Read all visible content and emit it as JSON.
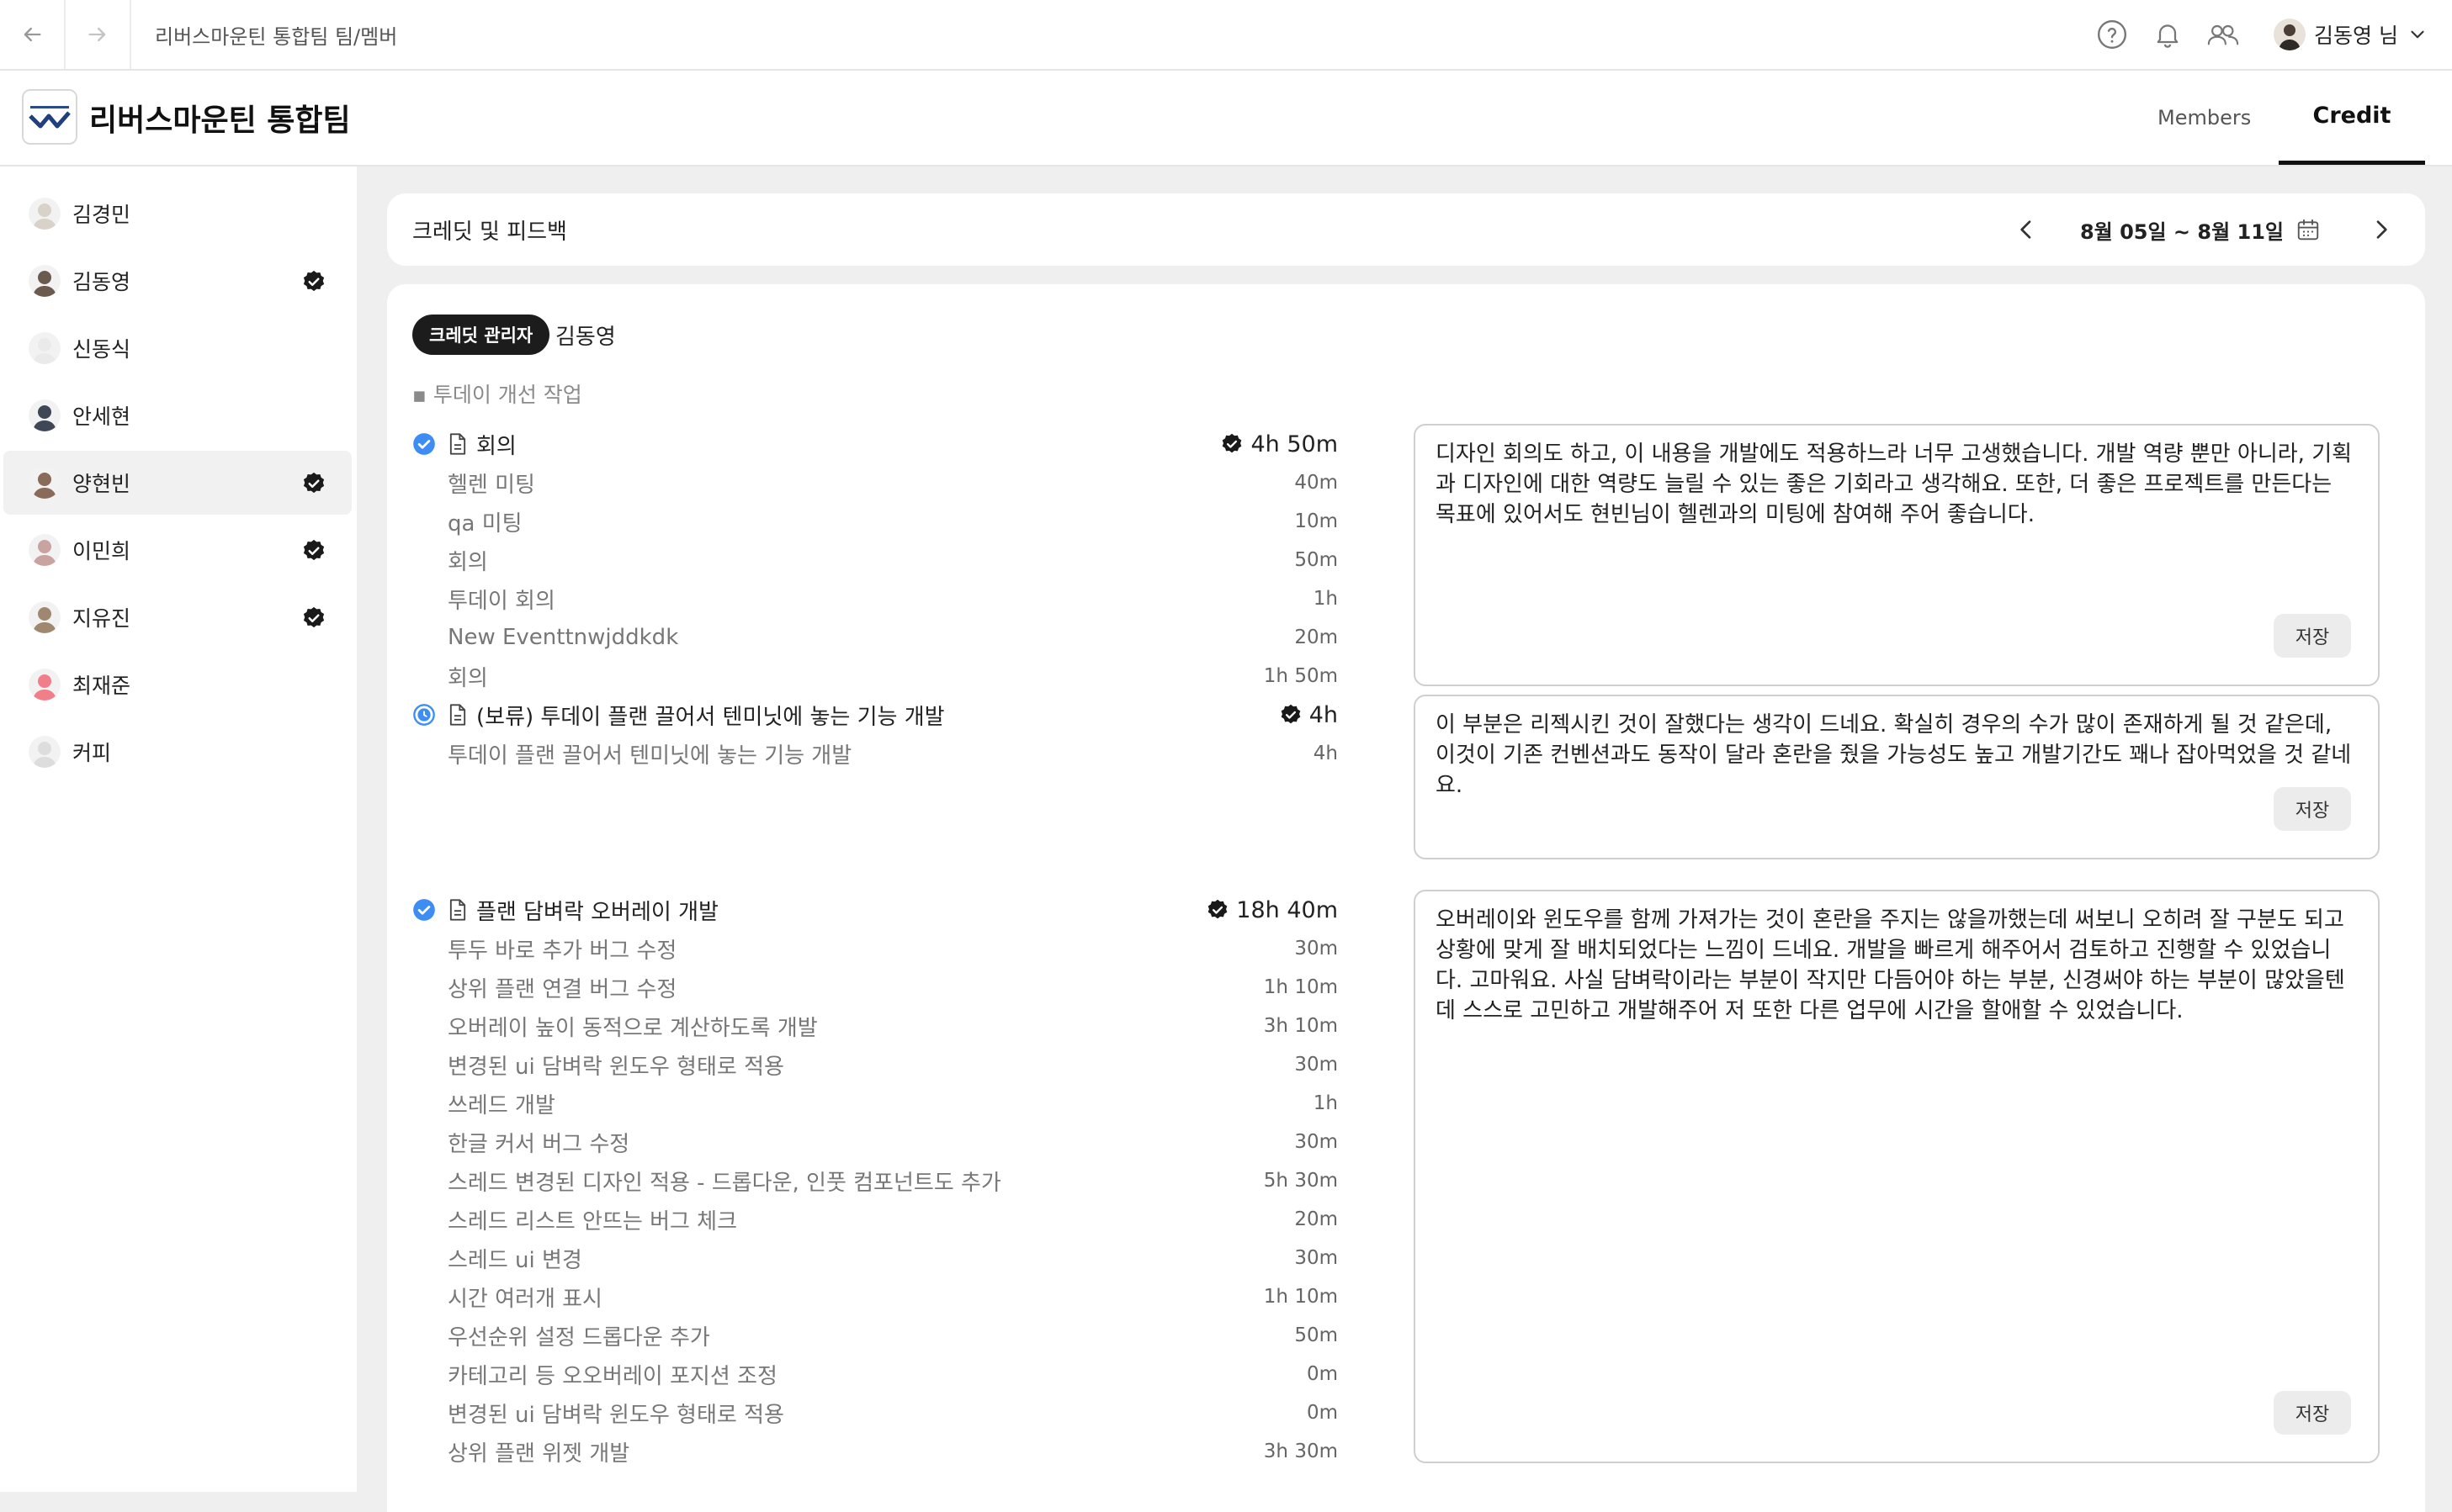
{
  "topbar": {
    "back_icon": "arrow-left-icon",
    "forward_icon": "arrow-right-icon",
    "breadcrumb": "리버스마운틴 통합팀 팀/멤버",
    "help_icon": "question-circle-icon",
    "bell_icon": "bell-icon",
    "people_icon": "people-icon",
    "user_name": "김동영 님",
    "dropdown_icon": "chevron-down-icon"
  },
  "team": {
    "name": "리버스마운틴 통합팀",
    "tabs": [
      {
        "label": "Members",
        "active": false
      },
      {
        "label": "Credit",
        "active": true
      }
    ]
  },
  "sidebar": {
    "members": [
      {
        "name": "김경민",
        "verified": false,
        "selected": false,
        "avatar_color": "#d9d2c8"
      },
      {
        "name": "김동영",
        "verified": true,
        "selected": false,
        "avatar_color": "#6b5b4f"
      },
      {
        "name": "신동식",
        "verified": false,
        "selected": false,
        "avatar_color": "#eaeaea"
      },
      {
        "name": "안세현",
        "verified": false,
        "selected": false,
        "avatar_color": "#3f4656"
      },
      {
        "name": "양현빈",
        "verified": true,
        "selected": true,
        "avatar_color": "#8a6a58"
      },
      {
        "name": "이민희",
        "verified": true,
        "selected": false,
        "avatar_color": "#c9a3a0"
      },
      {
        "name": "지유진",
        "verified": true,
        "selected": false,
        "avatar_color": "#a08870"
      },
      {
        "name": "최재준",
        "verified": false,
        "selected": false,
        "avatar_color": "#f07f8a"
      },
      {
        "name": "커피",
        "verified": false,
        "selected": false,
        "avatar_color": "#dddddd"
      }
    ]
  },
  "header_card": {
    "title": "크레딧 및 피드백",
    "prev_icon": "chevron-left-icon",
    "week": "8월 05일 ~ 8월 11일",
    "calendar_icon": "calendar-icon",
    "next_icon": "chevron-right-icon"
  },
  "credit": {
    "manager_pill": "크레딧 관리자",
    "manager_name": "김동영",
    "section": "▪ 투데이 개선 작업",
    "save_label": "저장",
    "groups": [
      {
        "title": "회의",
        "status": "done",
        "total": "4h 50m",
        "items": [
          {
            "title": "헬렌 미팅",
            "time": "40m"
          },
          {
            "title": "qa 미팅",
            "time": "10m"
          },
          {
            "title": "회의",
            "time": "50m"
          },
          {
            "title": "투데이 회의",
            "time": "1h"
          },
          {
            "title": "New Eventtnwjddkdk",
            "time": "20m"
          },
          {
            "title": "회의",
            "time": "1h 50m"
          }
        ],
        "feedback": "디자인 회의도 하고, 이 내용을 개발에도 적용하느라 너무 고생했습니다. 개발 역량 뿐만 아니라, 기획과 디자인에 대한 역량도 늘릴 수 있는 좋은 기회라고 생각해요. 또한, 더 좋은 프로젝트를 만든다는 목표에 있어서도 현빈님이 헬렌과의 미팅에 참여해 주어 좋습니다."
      },
      {
        "title": "(보류) 투데이 플랜 끌어서 텐미닛에 놓는 기능 개발",
        "status": "pending",
        "total": "4h",
        "items": [
          {
            "title": "투데이 플랜 끌어서 텐미닛에 놓는 기능 개발",
            "time": "4h"
          }
        ],
        "feedback": "이 부분은 리젝시킨 것이 잘했다는 생각이 드네요. 확실히 경우의 수가 많이 존재하게 될 것 같은데, 이것이 기존 컨벤션과도 동작이 달라 혼란을 줬을 가능성도 높고 개발기간도 꽤나 잡아먹었을 것 같네요."
      },
      {
        "title": "플랜 담벼락 오버레이 개발",
        "status": "done",
        "total": "18h 40m",
        "items": [
          {
            "title": "투두 바로 추가 버그 수정",
            "time": "30m"
          },
          {
            "title": "상위 플랜 연결 버그 수정",
            "time": "1h 10m"
          },
          {
            "title": "오버레이 높이 동적으로 계산하도록 개발",
            "time": "3h 10m"
          },
          {
            "title": "변경된 ui 담벼락 윈도우 형태로 적용",
            "time": "30m"
          },
          {
            "title": "쓰레드 개발",
            "time": "1h"
          },
          {
            "title": "한글 커서 버그 수정",
            "time": "30m"
          },
          {
            "title": "스레드 변경된 디자인 적용 - 드롭다운, 인풋 컴포넌트도 추가",
            "time": "5h 30m"
          },
          {
            "title": "스레드 리스트 안뜨는 버그 체크",
            "time": "20m"
          },
          {
            "title": "스레드 ui 변경",
            "time": "30m"
          },
          {
            "title": "시간 여러개 표시",
            "time": "1h 10m"
          },
          {
            "title": "우선순위 설정 드롭다운 추가",
            "time": "50m"
          },
          {
            "title": "카테고리 등 오오버레이 포지션 조정",
            "time": "0m"
          },
          {
            "title": "변경된 ui 담벼락 윈도우 형태로 적용",
            "time": "0m"
          },
          {
            "title": "상위 플랜 위젯 개발",
            "time": "3h 30m"
          }
        ],
        "feedback": "오버레이와 윈도우를 함께 가져가는 것이 혼란을 주지는 않을까했는데 써보니 오히려 잘 구분도 되고 상황에 맞게 잘 배치되었다는 느낌이 드네요. 개발을 빠르게 해주어서 검토하고 진행할 수 있었습니다. 고마워요. 사실 담벼락이라는 부분이 작지만 다듬어야 하는 부분, 신경써야 하는 부분이 많았을텐데 스스로 고민하고 개발해주어 저 또한 다른 업무에 시간을 할애할 수 있었습니다."
      }
    ]
  }
}
